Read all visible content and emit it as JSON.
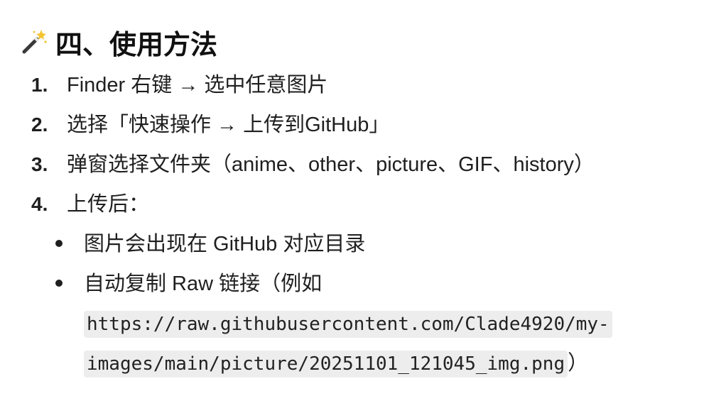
{
  "heading": {
    "icon": "magic-wand-icon",
    "text": "四、使用方法"
  },
  "steps": [
    {
      "num": "1.",
      "text": "Finder 右键 → 选中任意图片"
    },
    {
      "num": "2.",
      "text": "选择「快速操作 → 上传到GitHub」"
    },
    {
      "num": "3.",
      "text": "弹窗选择文件夹（anime、other、picture、GIF、history）"
    },
    {
      "num": "4.",
      "text": "上传后："
    }
  ],
  "sub_items": {
    "item1": "图片会出现在 GitHub 对应目录",
    "item2_prefix": "自动复制 Raw 链接（例如",
    "code_line1": "https://raw.githubusercontent.com/Clade4920/my-",
    "code_line2": "images/main/picture/20251101_121045_img.png",
    "suffix": "）"
  },
  "colors": {
    "text": "#1f1f1f",
    "code_bg": "#ededed"
  }
}
